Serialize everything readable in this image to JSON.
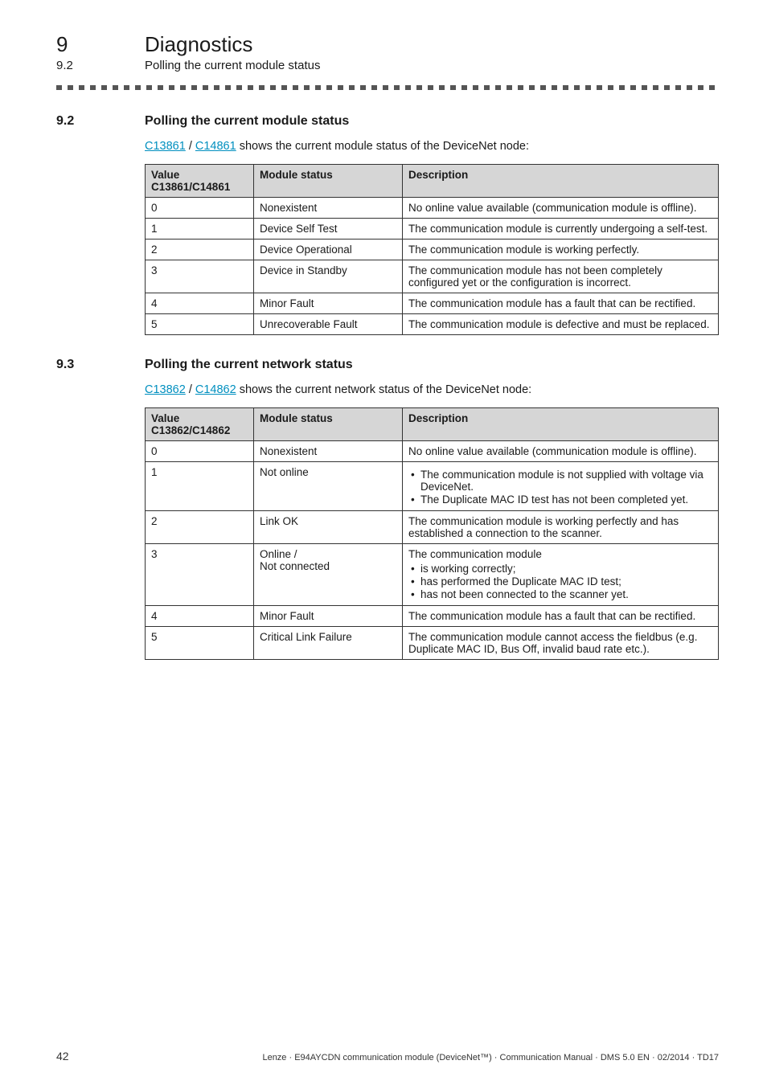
{
  "header": {
    "chapter_num": "9",
    "chapter_title": "Diagnostics",
    "sub_num": "9.2",
    "sub_title": "Polling the current module status"
  },
  "section_9_2": {
    "number": "9.2",
    "title": "Polling the current module status",
    "link1": "C13861",
    "sep": " / ",
    "link2": "C14861",
    "intro_tail": " shows the current module status of the DeviceNet node:",
    "th_value": "Value C13861/C14861",
    "th_module": "Module status",
    "th_desc": "Description",
    "rows": [
      {
        "value": "0",
        "module": "Nonexistent",
        "desc": "No online value available (communication module is offline)."
      },
      {
        "value": "1",
        "module": "Device Self Test",
        "desc": "The communication module is currently undergoing a self-test."
      },
      {
        "value": "2",
        "module": "Device Operational",
        "desc": "The communication module is working perfectly."
      },
      {
        "value": "3",
        "module": "Device in Standby",
        "desc": "The communication module has not been completely configured yet or the configuration is incorrect."
      },
      {
        "value": "4",
        "module": "Minor Fault",
        "desc": "The communication module has a fault that can be rectified."
      },
      {
        "value": "5",
        "module": "Unrecoverable Fault",
        "desc": "The communication module is defective and must be replaced."
      }
    ]
  },
  "section_9_3": {
    "number": "9.3",
    "title": "Polling the current network status",
    "link1": "C13862",
    "sep": " / ",
    "link2": "C14862",
    "intro_tail": " shows the current network status of the DeviceNet node:",
    "th_value": "Value C13862/C14862",
    "th_module": "Module status",
    "th_desc": "Description",
    "rows": [
      {
        "value": "0",
        "module": "Nonexistent",
        "desc": "No online value available (communication module is offline)."
      },
      {
        "value": "1",
        "module": "Not online",
        "desc_bullets": [
          "The communication module is not supplied with voltage via DeviceNet.",
          "The Duplicate MAC ID test has not been completed yet."
        ]
      },
      {
        "value": "2",
        "module": "Link OK",
        "desc": "The communication module is working perfectly and has established a connection to the scanner."
      },
      {
        "value": "3",
        "module_lines": [
          "Online /",
          "Not connected"
        ],
        "desc_lead": "The communication module",
        "desc_bullets": [
          "is working correctly;",
          "has performed the Duplicate MAC ID test;",
          "has not been connected to the scanner yet."
        ]
      },
      {
        "value": "4",
        "module": "Minor Fault",
        "desc": "The communication module has a fault that can be rectified."
      },
      {
        "value": "5",
        "module": "Critical Link Failure",
        "desc": "The communication module cannot access the fieldbus (e.g. Duplicate MAC ID, Bus Off, invalid baud rate etc.)."
      }
    ]
  },
  "footer": {
    "page": "42",
    "text": "Lenze · E94AYCDN communication module (DeviceNet™) · Communication Manual · DMS 5.0 EN · 02/2014 · TD17"
  }
}
